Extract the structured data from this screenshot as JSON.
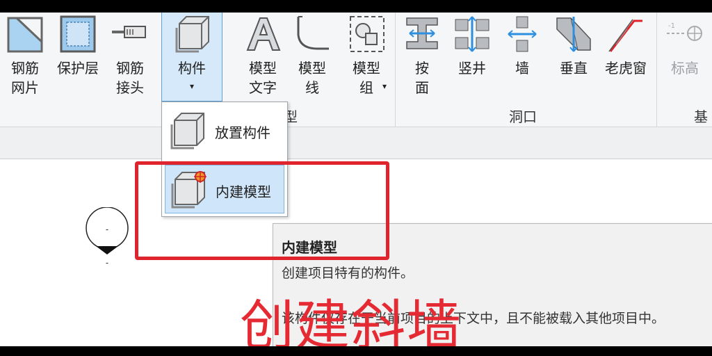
{
  "ribbon": {
    "tools": [
      {
        "id": "rebar-mesh",
        "label": "钢筋\n网片",
        "icon": "rebar-mesh-icon",
        "disabled": false
      },
      {
        "id": "cover",
        "label": "保护层",
        "icon": "cover-layer-icon",
        "disabled": false
      },
      {
        "id": "rebar-coupler",
        "label": "钢筋\n接头",
        "icon": "rebar-coupler-icon",
        "disabled": false
      },
      {
        "id": "component",
        "label": "构件",
        "icon": "component-icon",
        "disabled": false
      },
      {
        "id": "model-text",
        "label": "模型\n文字",
        "icon": "model-text-icon",
        "disabled": false
      },
      {
        "id": "model-line",
        "label": "模型\n线",
        "icon": "model-line-icon",
        "disabled": false
      },
      {
        "id": "model-group",
        "label": "模型\n组",
        "icon": "model-group-icon",
        "disabled": false
      },
      {
        "id": "by-face",
        "label": "按\n面",
        "icon": "by-face-opening-icon",
        "disabled": false
      },
      {
        "id": "shaft",
        "label": "竖井",
        "icon": "shaft-opening-icon",
        "disabled": false
      },
      {
        "id": "wall",
        "label": "墙",
        "icon": "wall-opening-icon",
        "disabled": false
      },
      {
        "id": "vertical",
        "label": "垂直",
        "icon": "vertical-opening-icon",
        "disabled": false
      },
      {
        "id": "dormer",
        "label": "老虎窗",
        "icon": "dormer-opening-icon",
        "disabled": false
      },
      {
        "id": "level",
        "label": "标高",
        "icon": "level-icon",
        "disabled": true
      }
    ],
    "panels": {
      "model_suffix": "型",
      "opening": "洞口",
      "datum_partial": "基"
    }
  },
  "dropdown": {
    "items": [
      {
        "label": "放置构件",
        "icon": "place-component-icon"
      },
      {
        "label": "内建模型",
        "icon": "in-place-model-icon"
      }
    ]
  },
  "tooltip": {
    "title": "内建模型",
    "description": "创建项目特有的构件。",
    "detail": "该构件仅存在于当前项目的上下文中，且不能被载入其他项目中。"
  },
  "overlay_caption": "创建斜墙",
  "tag_text": "-",
  "colors": {
    "highlight": "#d6e9fa",
    "annotation": "#e0242d",
    "caption": "#e52a33"
  }
}
